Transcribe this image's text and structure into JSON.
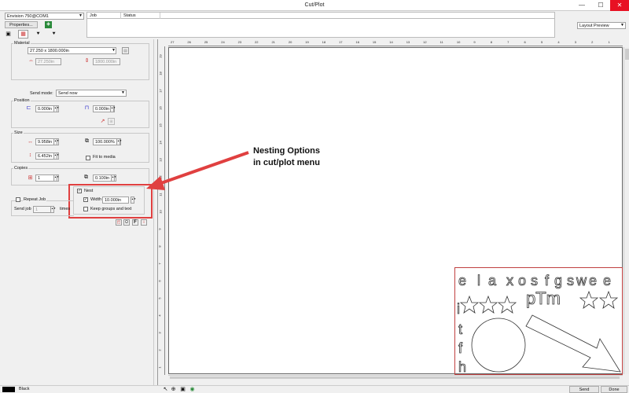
{
  "window": {
    "title": "Cut/Plot",
    "minimize": "—",
    "maximize": "☐",
    "close": "✕"
  },
  "device": {
    "selected": "Envision 750@COM1"
  },
  "toolbar": {
    "properties_label": "Properties..."
  },
  "job_table": {
    "columns": [
      "Job",
      "Status"
    ]
  },
  "view_mode": {
    "selected": "Layout Preview"
  },
  "material": {
    "label": "Material",
    "size": "27.250 x 1800.000in",
    "width": "27.250in",
    "length": "1800.000in"
  },
  "send_mode": {
    "label": "Send mode:",
    "value": "Send now"
  },
  "position": {
    "label": "Position",
    "x": "0.000in",
    "y": "0.000in"
  },
  "size": {
    "label": "Size",
    "width": "9.958in",
    "height": "6.452in",
    "scale": "100.000%",
    "fit_label": "Fit to media"
  },
  "copies": {
    "label": "Copies",
    "count": "1",
    "spacing": "0.100in"
  },
  "nest": {
    "label": "Nest",
    "checked": true,
    "width_label": "Width",
    "width_checked": true,
    "width_value": "10.000in",
    "keep_label": "Keep groups and text",
    "keep_checked": false
  },
  "repeat": {
    "label": "Repeat Job",
    "send_label": "Send job",
    "count": "1",
    "times_label": "times"
  },
  "annotation": {
    "line1": "Nesting Options",
    "line2": "in cut/plot menu",
    "color": "#e04040"
  },
  "ruler_top": [
    "27",
    "26",
    "25",
    "24",
    "23",
    "22",
    "21",
    "20",
    "19",
    "18",
    "17",
    "16",
    "15",
    "14",
    "13",
    "12",
    "11",
    "10",
    "9",
    "8",
    "7",
    "6",
    "5",
    "4",
    "3",
    "2",
    "1"
  ],
  "ruler_left": [
    "19",
    "18",
    "17",
    "16",
    "15",
    "14",
    "13",
    "12",
    "11",
    "10",
    "9",
    "8",
    "7",
    "6",
    "5",
    "4",
    "3",
    "2",
    "1"
  ],
  "artwork": {
    "color_box": "#c04040",
    "letters_row1": [
      "e",
      "l",
      "a",
      "x",
      "o",
      "s",
      "f",
      "g",
      "s",
      "w",
      "e",
      "e"
    ],
    "letters_col": [
      "i",
      "t",
      "f",
      "h"
    ],
    "pm": "pTm"
  },
  "status": {
    "color_name": "Black",
    "send_label": "Send",
    "done_label": "Done"
  }
}
